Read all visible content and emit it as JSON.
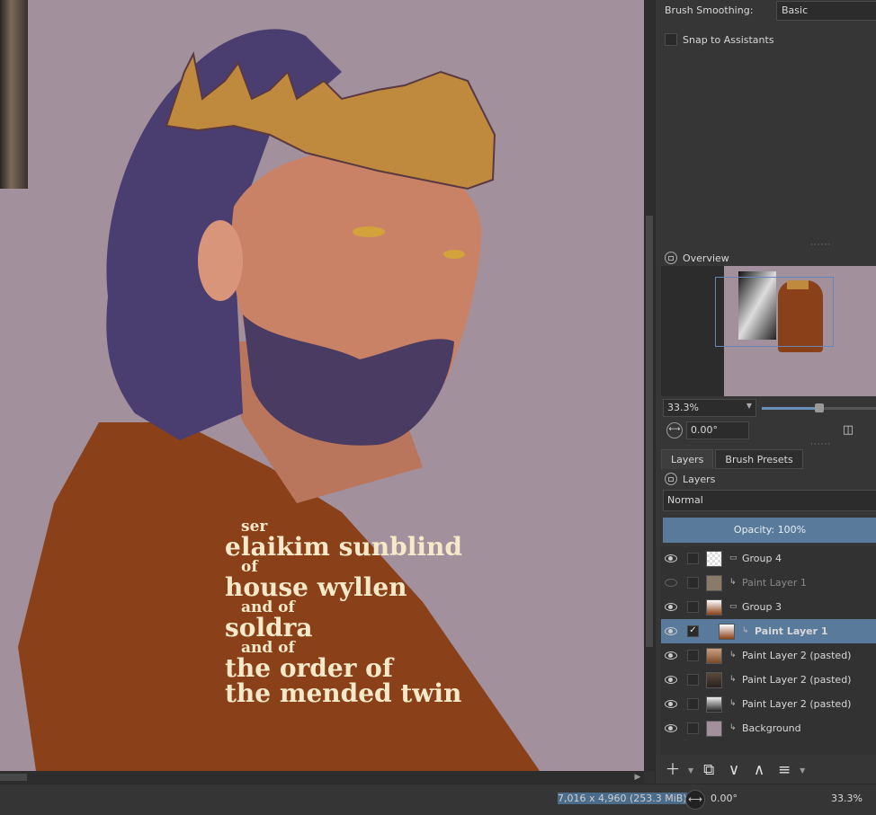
{
  "poster": {
    "line1": "ser",
    "line2": "elaikim sunblind",
    "line3": "of",
    "line4": "house wyllen",
    "line5": "and of",
    "line6": "soldra",
    "line7": "and of",
    "line8": "the order of",
    "line9": "the mended twin"
  },
  "tool_options": {
    "brush_smoothing_label": "Brush Smoothing:",
    "brush_smoothing_value": "Basic",
    "snap_label": "Snap to Assistants"
  },
  "overview": {
    "title": "Overview",
    "zoom": "33.3%",
    "zoom_fraction": 0.5,
    "rotation": "0.00°"
  },
  "layers_panel": {
    "tabs": [
      "Layers",
      "Brush Presets"
    ],
    "title": "Layers",
    "blend_mode": "Normal",
    "opacity": "Opacity:  100%",
    "layers": [
      {
        "name": "Group 4",
        "visible": true,
        "type": "group",
        "indent": false,
        "selected": false
      },
      {
        "name": "Paint Layer 1",
        "visible": false,
        "type": "paint",
        "indent": false,
        "selected": false
      },
      {
        "name": "Group 3",
        "visible": true,
        "type": "group",
        "indent": false,
        "selected": false
      },
      {
        "name": "Paint Layer 1",
        "visible": true,
        "type": "paint",
        "indent": true,
        "selected": true
      },
      {
        "name": "Paint Layer 2 (pasted)",
        "visible": true,
        "type": "paint",
        "indent": false,
        "selected": false
      },
      {
        "name": "Paint Layer 2 (pasted)",
        "visible": true,
        "type": "paint",
        "indent": false,
        "selected": false
      },
      {
        "name": "Paint Layer 2 (pasted)",
        "visible": true,
        "type": "paint",
        "indent": false,
        "selected": false
      },
      {
        "name": "Background",
        "visible": true,
        "type": "paint",
        "indent": false,
        "selected": false
      }
    ]
  },
  "status_bar": {
    "image_size": "7,016 x 4,960 (253.3 MiB)",
    "rotation": "0.00°",
    "zoom": "33.3%"
  },
  "colors": {
    "canvas_bg": "#a3909d",
    "cloak": "#8a4119",
    "crown": "#c08a3e",
    "text": "#f6e9c9",
    "selection": "#5a7a9c"
  }
}
